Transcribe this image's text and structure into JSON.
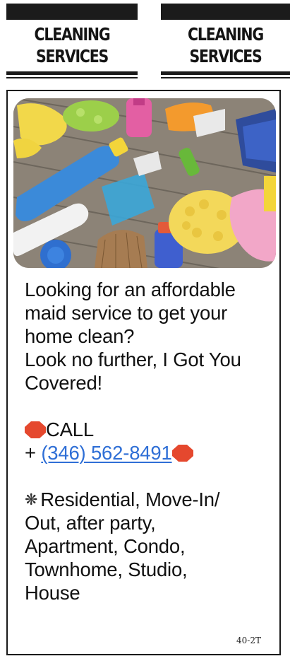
{
  "header": {
    "left_heading": [
      "CLEANING",
      "SERVICES"
    ],
    "right_heading": [
      "CLEANING",
      "SERVICES"
    ]
  },
  "ad": {
    "photo_icon": "cleaning-supplies-photo",
    "lines": {
      "l1": "Looking for an affordable",
      "l2": "maid service to get your",
      "l3": "home clean?",
      "l4": "Look no further, I Got You",
      "l5": "Covered!"
    },
    "call_label": "CALL",
    "phone_prefix": "+ ",
    "phone_number": "(346) 562-8491",
    "services": {
      "s1": "Residential, Move-In/",
      "s2": "Out, after party,",
      "s3": "Apartment, Condo,",
      "s4": "Townhome, Studio,",
      "s5": "House"
    },
    "sparkle_glyph": "❋",
    "code": "40-2T",
    "colors": {
      "link": "#2f6fd6",
      "stop_sign": "#e5482e"
    }
  }
}
